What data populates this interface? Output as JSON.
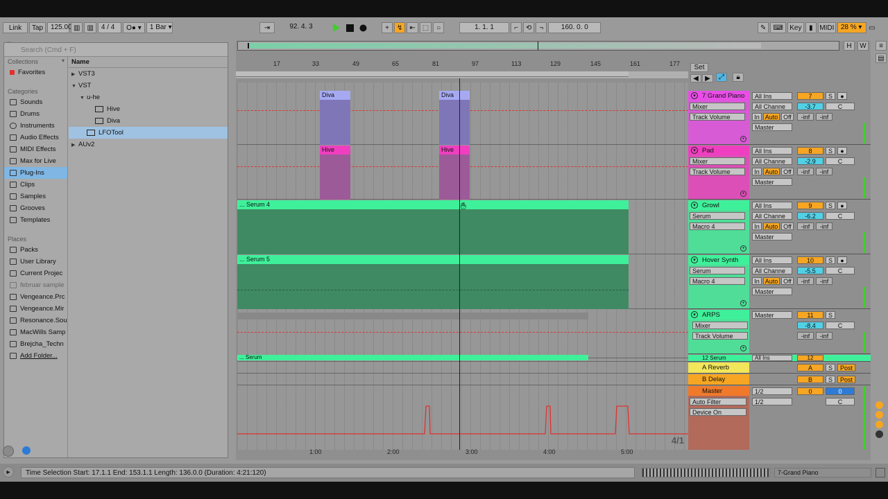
{
  "transport": {
    "link": "Link",
    "tap": "Tap",
    "tempo": "125.00",
    "signature": "4 / 4",
    "quantize": "1 Bar",
    "position": "92.   4.   3",
    "loop_start": "1.   1.   1",
    "loop_length": "160.   0.   0",
    "key": "Key",
    "midi": "MIDI",
    "cpu": "28 %"
  },
  "browser": {
    "search_placeholder": "Search (Cmd + F)",
    "collections_label": "Collections",
    "favorites": "Favorites",
    "categories_label": "Categories",
    "categories": [
      "Sounds",
      "Drums",
      "Instruments",
      "Audio Effects",
      "MIDI Effects",
      "Max for Live",
      "Plug-Ins",
      "Clips",
      "Samples",
      "Grooves",
      "Templates"
    ],
    "places_label": "Places",
    "places": [
      "Packs",
      "User Library",
      "Current Projec",
      "februar sample",
      "Vengeance.Prc",
      "Vengeance.Mir",
      "Resonance.Sou",
      "MacWills Samp",
      "Brejcha_Techn",
      "Add Folder..."
    ],
    "name_header": "Name",
    "tree": [
      "VST3",
      "VST",
      "u-he",
      "Hive",
      "Diva",
      "LFOTool",
      "AUv2"
    ]
  },
  "arrangement": {
    "ruler": [
      "17",
      "33",
      "49",
      "65",
      "81",
      "97",
      "113",
      "129",
      "145",
      "161",
      "177"
    ],
    "time_ruler": [
      "1:00",
      "2:00",
      "3:00",
      "4:00",
      "5:00"
    ],
    "set_label": "Set",
    "overview_labels": [
      "H",
      "W"
    ],
    "clips": {
      "diva": "Diva",
      "hive": "Hive",
      "serum4": "... Serum 4",
      "serum5": "... Serum 5",
      "serum": "... Serum"
    },
    "zoom": "4/1"
  },
  "tracks": [
    {
      "name": "7 Grand Piano",
      "color": "#e84ee6",
      "input": "All Ins",
      "channel": "All Channe",
      "device": "Mixer",
      "param": "Track Volume",
      "out": "Master",
      "num": "7",
      "vol": "-3.7",
      "pan": "C",
      "in": "In",
      "auto": "Auto",
      "off": "Off",
      "s": "S",
      "inf1": "-inf",
      "inf2": "-inf"
    },
    {
      "name": "Pad",
      "color": "#ef3fc0",
      "input": "All Ins",
      "channel": "All Channe",
      "device": "Mixer",
      "param": "Track Volume",
      "out": "Master",
      "num": "8",
      "vol": "-2.9",
      "pan": "C",
      "in": "In",
      "auto": "Auto",
      "off": "Off",
      "s": "S",
      "inf1": "-inf",
      "inf2": "-inf"
    },
    {
      "name": "Growl",
      "color": "#3ff09a",
      "input": "All Ins",
      "channel": "All Channe",
      "device": "Serum",
      "param": "Macro 4",
      "out": "Master",
      "num": "9",
      "vol": "-6.2",
      "pan": "C",
      "in": "In",
      "auto": "Auto",
      "off": "Off",
      "s": "S",
      "inf1": "-inf",
      "inf2": "-inf"
    },
    {
      "name": "Hover Synth",
      "color": "#3ff09a",
      "input": "All Ins",
      "channel": "All Channe",
      "device": "Serum",
      "param": "Macro 4",
      "out": "Master",
      "num": "10",
      "vol": "-5.5",
      "pan": "C",
      "in": "In",
      "auto": "Auto",
      "off": "Off",
      "s": "S",
      "inf1": "-inf",
      "inf2": "-inf"
    },
    {
      "name": "ARPS",
      "color": "#3ff09a",
      "input": "Master",
      "device": "Mixer",
      "param": "Track Volume",
      "num": "11",
      "vol": "-8.4",
      "pan": "C",
      "s": "S",
      "inf1": "-inf",
      "inf2": "-inf"
    }
  ],
  "track12": {
    "name": "12 Serum",
    "input": "All Ins",
    "num": "12"
  },
  "returns": [
    {
      "name": "A Reverb",
      "color": "#f2e65a",
      "num": "A",
      "s": "S",
      "post": "Post"
    },
    {
      "name": "B Delay",
      "color": "#f6a623",
      "num": "B",
      "s": "S",
      "post": "Post"
    }
  ],
  "master": {
    "name": "Master",
    "color": "#f07a2a",
    "cue": "1/2",
    "out": "1/2",
    "num": "0",
    "vol": "0",
    "pan": "C",
    "device1": "Auto Filter",
    "device2": "Device On"
  },
  "status": {
    "text": "Time Selection   Start: 17.1.1   End: 153.1.1   Length: 136.0.0 (Duration: 4:21:120)",
    "track_name": "7-Grand Piano"
  }
}
